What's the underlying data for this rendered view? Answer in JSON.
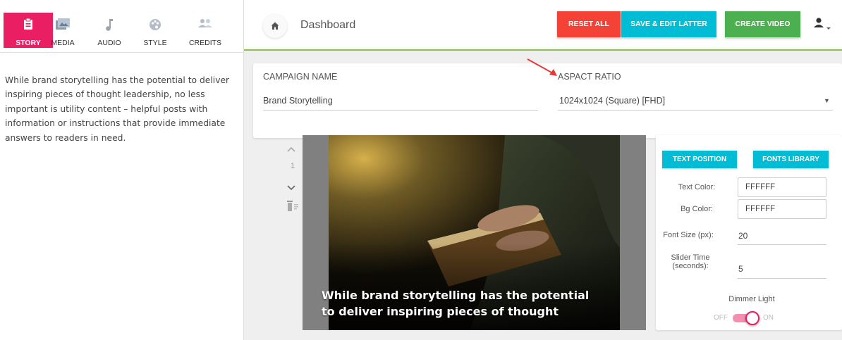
{
  "tabs": [
    {
      "label": "STORY",
      "icon": "clipboard-icon",
      "active": true
    },
    {
      "label": "MEDIA",
      "icon": "photos-icon",
      "active": false
    },
    {
      "label": "AUDIO",
      "icon": "music-note-icon",
      "active": false
    },
    {
      "label": "STYLE",
      "icon": "palette-icon",
      "active": false
    },
    {
      "label": "CREDITS",
      "icon": "people-icon",
      "active": false
    }
  ],
  "story": {
    "text": "While brand storytelling has the potential to deliver inspiring pieces of thought leadership, no less important is utility content – helpful posts with information or instructions that provide immediate answers to readers in need."
  },
  "header": {
    "title": "Dashboard",
    "reset_label": "RESET ALL",
    "save_label": "SAVE & EDIT LATTER",
    "create_label": "CREATE VIDEO"
  },
  "campaign": {
    "name_label": "CAMPAIGN NAME",
    "name_value": "Brand Storytelling",
    "ratio_label": "ASPACT RATIO",
    "ratio_value": "1024x1024 (Square) [FHD]"
  },
  "slides": {
    "current": "1"
  },
  "preview": {
    "caption": "While brand storytelling has the potential to deliver inspiring pieces of thought"
  },
  "settings": {
    "text_position_label": "TEXT POSITION",
    "fonts_library_label": "FONTS LIBRARY",
    "text_color_label": "Text Color:",
    "text_color_value": "FFFFFF",
    "bg_color_label": "Bg Color:",
    "bg_color_value": "FFFFFF",
    "font_size_label": "Font Size (px):",
    "font_size_value": "20",
    "slider_time_label_1": "Slider Time",
    "slider_time_label_2": "(seconds):",
    "slider_time_value": "5",
    "dimmer_label": "Dimmer Light",
    "toggle_off": "OFF",
    "toggle_on": "ON",
    "dimmer_on": true
  },
  "colors": {
    "accent_pink": "#e91e63",
    "reset_red": "#f44336",
    "save_cyan": "#00bcd4",
    "create_green": "#4caf50"
  }
}
